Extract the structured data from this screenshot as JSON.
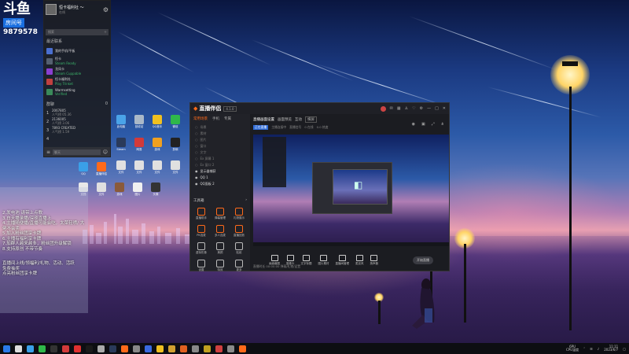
{
  "douyu": {
    "logo": "斗鱼",
    "room_label": "房间号",
    "room_number": "9879578"
  },
  "qq": {
    "nickname": "恒卡福利社 ～",
    "status": "在线",
    "search_placeholder": "搜索",
    "section_title": "最近联系",
    "contacts": [
      {
        "name": "我的手机/平板",
        "sub": "",
        "icon": "phone-icon",
        "color": "#4a6fd0"
      },
      {
        "name": "恒卡",
        "sub": "Steam Ready",
        "icon": "steam-icon",
        "color": "#556070"
      },
      {
        "name": "龙凤卡",
        "sub": "Steam Cuppable",
        "icon": "game-icon",
        "color": "#8a3fd0"
      },
      {
        "name": "恒卡福利社",
        "sub": "Play Trinket",
        "icon": "group-icon",
        "color": "#c04040"
      },
      {
        "name": "Warmsetting",
        "sub": "Verified",
        "icon": "setting-icon",
        "color": "#3a8a5a"
      }
    ],
    "group_header": "群聊",
    "group_count": "0",
    "groups": [
      {
        "n": "1",
        "name": "2067805",
        "sub": "人气榜 05.36"
      },
      {
        "n": "2",
        "name": "2136005",
        "sub": "人气榜 3.06"
      },
      {
        "n": "3",
        "name": "7893 CREATED",
        "sub": "人气榜 1.59"
      },
      {
        "n": "4",
        "name": "",
        "sub": ""
      }
    ],
    "bottom_placeholder": "聊天"
  },
  "desktop_icons": [
    {
      "label": "此电脑",
      "color": "#4aa3e8"
    },
    {
      "label": "回收站",
      "color": "#aab8c8"
    },
    {
      "label": "QQ音乐",
      "color": "#f0c020"
    },
    {
      "label": "微信",
      "color": "#2fb84a"
    },
    {
      "label": "Steam",
      "color": "#2a3a5a"
    },
    {
      "label": "网易",
      "color": "#d23a3a"
    },
    {
      "label": "游戏",
      "color": "#f0a020"
    },
    {
      "label": "剪映",
      "color": "#222"
    },
    {
      "label": "文件",
      "color": "#e0e0e0"
    },
    {
      "label": "文件",
      "color": "#e0e0e0"
    },
    {
      "label": "文件",
      "color": "#e0e0e0"
    },
    {
      "label": "文件",
      "color": "#e0e0e0"
    },
    {
      "label": "QQ",
      "color": "#3aa0e8"
    },
    {
      "label": "直播伴侣",
      "color": "#ff6a1a"
    },
    {
      "label": "文档",
      "color": "#e8e8e8"
    },
    {
      "label": "文件",
      "color": "#e0e0e0"
    },
    {
      "label": "游戏",
      "color": "#8a5a3a"
    },
    {
      "label": "图片",
      "color": "#f0f0f0"
    },
    {
      "label": "头像",
      "color": "#333"
    }
  ],
  "overlay_text": [
    "2.发电池 请带上点歌",
    "3.白天播录播/深夜直播上",
    "4.主播随便播/直播可能会吃，太菜轻喷/ 大佬不会卖",
    "5.加入粉丝团享卡牌",
    "6.主播有福利享卡牌",
    "7.加群人越来越多，粉丝团升级解锁",
    "8.支持原创 不带节奏",
    "",
    "",
    "直播间上线/领福利/礼物、活动、活跃",
    "免费抽奖",
    "点亮粉丝团享卡牌"
  ],
  "streamer": {
    "brand": "直播伴侣",
    "version": "4.1.0",
    "left_tabs": [
      "常用场景",
      "手机",
      "专属"
    ],
    "scenes": [
      {
        "label": "场景",
        "active": false
      },
      {
        "label": "素材",
        "active": false
      },
      {
        "label": "图片",
        "active": false
      },
      {
        "label": "窗口",
        "active": false
      },
      {
        "label": "文字",
        "active": false
      },
      {
        "label": "Ex 屏幕 1",
        "active": false
      },
      {
        "label": "Ex 窗口 2",
        "active": false
      },
      {
        "label": "显示器捕获",
        "active": true
      },
      {
        "label": "QQ 1",
        "active": true
      },
      {
        "label": "QQ面板 2",
        "active": true
      }
    ],
    "tools_title": "工具箱",
    "tools": [
      {
        "label": "直播助手",
        "accent": true
      },
      {
        "label": "弹幕管理",
        "accent": true
      },
      {
        "label": "礼物展示",
        "accent": true
      },
      {
        "label": "PK连麦",
        "accent": true
      },
      {
        "label": "多人连麦",
        "accent": true
      },
      {
        "label": "直播回放",
        "accent": true
      },
      {
        "label": "虚拟形象",
        "accent": false
      },
      {
        "label": "美颜",
        "accent": false
      },
      {
        "label": "贴纸",
        "accent": false
      },
      {
        "label": "设置",
        "accent": false
      },
      {
        "label": "特效",
        "accent": false
      },
      {
        "label": "更多",
        "accent": false
      }
    ],
    "main_tabs": [
      "直播画面设置",
      "画面预览",
      "互动"
    ],
    "main_badge": "横屏",
    "info_tag": "正在直播",
    "info_items": [
      "主播连接中",
      "直播信号",
      "0 在线",
      "0.0 热度"
    ],
    "bottom_buttons": [
      "画面截图",
      "摄像头",
      "文字标题",
      "图片素材",
      "直播间管理",
      "麦克风",
      "扬声器"
    ],
    "end_button": "开始直播",
    "footer": "直播时长 00:00:00  弹幕/礼物/设置"
  },
  "taskbar": {
    "icons": [
      "#2a7ae8",
      "#dddddd",
      "#3aa0e8",
      "#2fb84a",
      "#333",
      "#d23a3a",
      "#e03030",
      "#1a1a1a",
      "#aaa",
      "#2a3a5a",
      "#ff6a1a",
      "#888",
      "#3a6ae0",
      "#f0c020",
      "#d0a030",
      "#e06020",
      "#888888",
      "#c0a020",
      "#d04040",
      "#8a8a8a",
      "#ff6a1a"
    ],
    "tray_left": "6PU",
    "tray_label": "CPU温度",
    "time": "11:11",
    "date": "2023/6/7"
  }
}
